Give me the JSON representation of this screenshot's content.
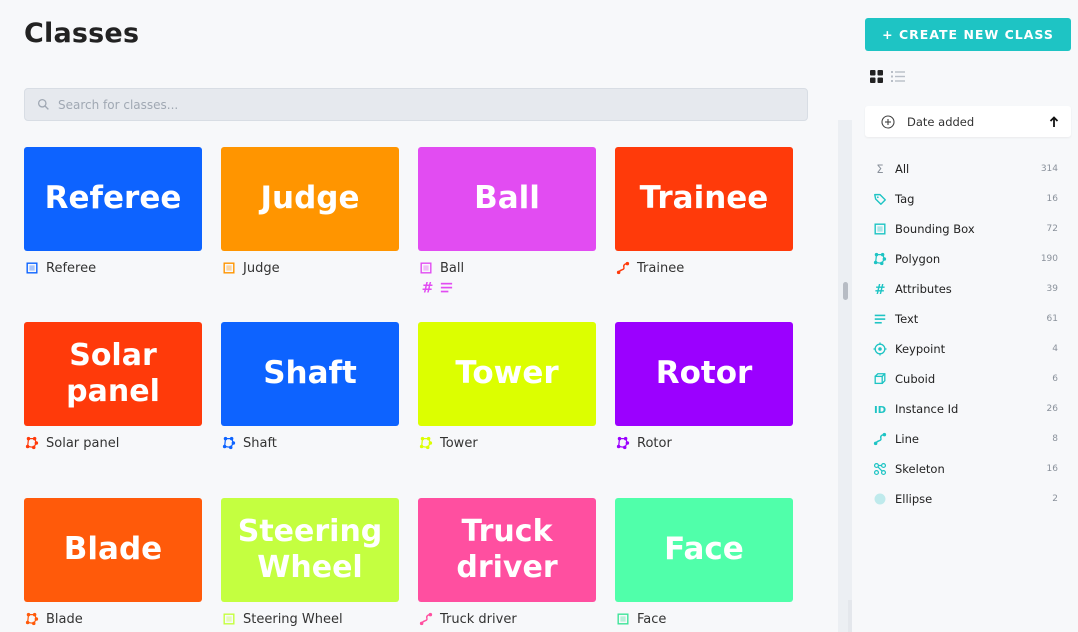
{
  "page_title": "Classes",
  "search": {
    "placeholder": "Search for classes..."
  },
  "colors": {
    "accent": "#1ec4c4"
  },
  "classes": [
    {
      "title": "Referee",
      "name": "Referee",
      "bg": "#0d63ff",
      "icon": "bounding-box-icon",
      "icon_color": "#0d63ff"
    },
    {
      "title": "Judge",
      "name": "Judge",
      "bg": "#ff9500",
      "icon": "bounding-box-icon",
      "icon_color": "#ff9500"
    },
    {
      "title": "Ball",
      "name": "Ball",
      "bg": "#e24cf2",
      "icon": "bounding-box-icon",
      "icon_color": "#e24cf2"
    },
    {
      "title": "Trainee",
      "name": "Trainee",
      "bg": "#ff3a0a",
      "icon": "line-icon",
      "icon_color": "#ff3a0a"
    },
    {
      "title": "Solar panel",
      "name": "Solar panel",
      "bg": "#ff3a0a",
      "icon": "polygon-icon",
      "icon_color": "#ff3a0a"
    },
    {
      "title": "Shaft",
      "name": "Shaft",
      "bg": "#0d63ff",
      "icon": "polygon-icon",
      "icon_color": "#0d63ff"
    },
    {
      "title": "Tower",
      "name": "Tower",
      "bg": "#dcff00",
      "icon": "polygon-icon",
      "icon_color": "#dcff00"
    },
    {
      "title": "Rotor",
      "name": "Rotor",
      "bg": "#9b00ff",
      "icon": "polygon-icon",
      "icon_color": "#9b00ff"
    },
    {
      "title": "Blade",
      "name": "Blade",
      "bg": "#ff5a0a",
      "icon": "polygon-icon",
      "icon_color": "#ff5a0a"
    },
    {
      "title": "Steering Wheel",
      "name": "Steering Wheel",
      "bg": "#c4ff40",
      "icon": "bounding-box-icon",
      "icon_color": "#c4ff40"
    },
    {
      "title": "Truck driver",
      "name": "Truck driver",
      "bg": "#ff4fa0",
      "icon": "line-icon",
      "icon_color": "#ff4fa0"
    },
    {
      "title": "Face",
      "name": "Face",
      "bg": "#50ffaa",
      "icon": "bounding-box-icon",
      "icon_color": "#3fe39a"
    }
  ],
  "ball_extra_icons": [
    "attributes-icon",
    "text-icon"
  ],
  "sidebar": {
    "create_label": "+ CREATE NEW CLASS",
    "view_modes": [
      "grid-view-icon",
      "list-view-icon"
    ],
    "sort": {
      "label": "Date added",
      "direction_icon": "arrow-up-icon"
    },
    "filters": [
      {
        "label": "All",
        "count": "314",
        "icon": "sigma-icon"
      },
      {
        "label": "Tag",
        "count": "16",
        "icon": "tag-icon"
      },
      {
        "label": "Bounding Box",
        "count": "72",
        "icon": "bounding-box-icon"
      },
      {
        "label": "Polygon",
        "count": "190",
        "icon": "polygon-icon"
      },
      {
        "label": "Attributes",
        "count": "39",
        "icon": "attributes-icon"
      },
      {
        "label": "Text",
        "count": "61",
        "icon": "text-icon"
      },
      {
        "label": "Keypoint",
        "count": "4",
        "icon": "keypoint-icon"
      },
      {
        "label": "Cuboid",
        "count": "6",
        "icon": "cuboid-icon"
      },
      {
        "label": "Instance Id",
        "count": "26",
        "icon": "instance-id-icon"
      },
      {
        "label": "Line",
        "count": "8",
        "icon": "line-icon"
      },
      {
        "label": "Skeleton",
        "count": "16",
        "icon": "skeleton-icon"
      },
      {
        "label": "Ellipse",
        "count": "2",
        "icon": "ellipse-icon"
      }
    ]
  }
}
